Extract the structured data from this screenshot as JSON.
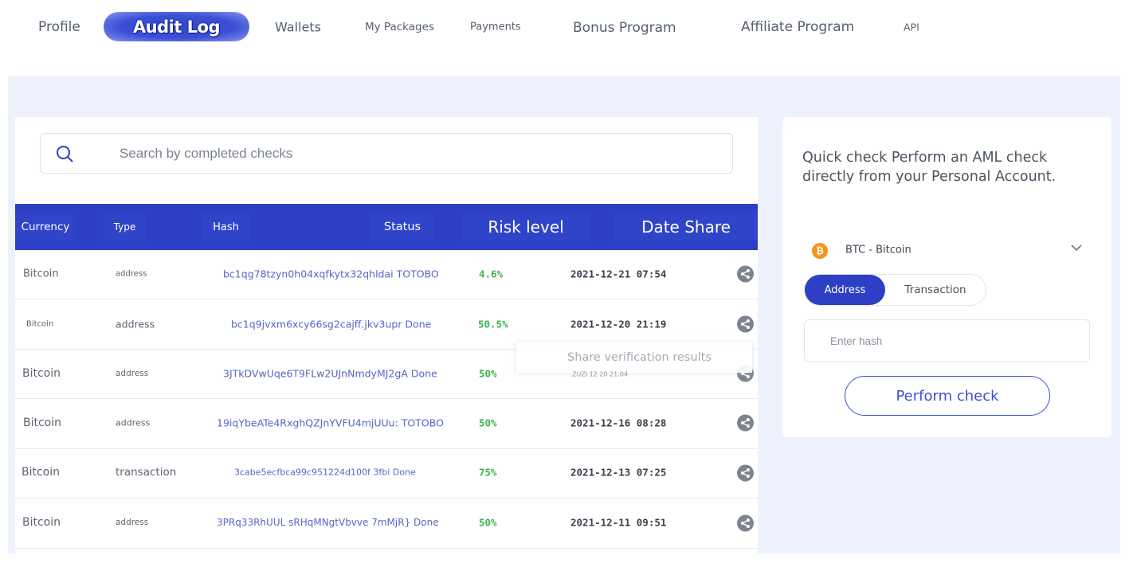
{
  "nav": {
    "items": [
      {
        "label": "Profile"
      },
      {
        "label": "Audit Log"
      },
      {
        "label": "Wallets"
      },
      {
        "label": "My Packages"
      },
      {
        "label": "Payments"
      },
      {
        "label": "Bonus Program"
      },
      {
        "label": "Affiliate Program"
      },
      {
        "label": "API"
      }
    ],
    "active": "Audit Log"
  },
  "search": {
    "icon": "search-icon",
    "placeholder": "Search by completed checks"
  },
  "table": {
    "headers": {
      "currency": "Currency",
      "type": "Type",
      "hash": "Hash",
      "status": "Status",
      "risk": "Risk level",
      "date_share": "Date Share"
    },
    "rows": [
      {
        "currency": "Bitcoin",
        "type": "address",
        "hash": "bc1qg78tzyn0h04xqfkytx32qhldai TOTOBO",
        "risk": "4.6%",
        "date": "2021-12-21 07:54"
      },
      {
        "currency": "Bitcoin",
        "type": "address",
        "hash": "bc1q9jvxm6xcy66sg2cajff.jkv3upr Done",
        "risk": "50.5%",
        "date": "2021-12-20 21:19"
      },
      {
        "currency": "Bitcoin",
        "type": "address",
        "hash": "3JTkDVwUqe6T9FLw2UJnNmdyMJ2gA Done",
        "risk": "50%",
        "date": ""
      },
      {
        "currency": "Bitcoin",
        "type": "address",
        "hash": "19iqYbeATe4RxghQZJnYVFU4mjUUu: TOTOBO",
        "risk": "50%",
        "date": "2021-12-16 08:28"
      },
      {
        "currency": "Bitcoin",
        "type": "transaction",
        "hash": "3cabe5ecfbca99c951224d100f 3fbi Done",
        "risk": "75%",
        "date": "2021-12-13 07:25"
      },
      {
        "currency": "Bitcoin",
        "type": "address",
        "hash": "3PRq33RhUUL sRHqMNgtVbvve 7mMjR} Done",
        "risk": "50%",
        "date": "2021-12-11 09:51"
      }
    ]
  },
  "tooltip": {
    "title": "Share verification results",
    "sub": "ZUZI 12 20 21.04"
  },
  "quick_check": {
    "title": "Quick check Perform an AML check directly from your Personal Account.",
    "currency_label": "BTC - Bitcoin",
    "currency_icon": "bitcoin-icon",
    "tab_address": "Address",
    "tab_transaction": "Transaction",
    "hash_placeholder": "Enter hash",
    "button": "Perform check"
  },
  "colors": {
    "primary": "#2d40c5",
    "risk_green": "#3bb54a",
    "bitcoin": "#f7931a",
    "page_bg": "#eef2fd"
  }
}
